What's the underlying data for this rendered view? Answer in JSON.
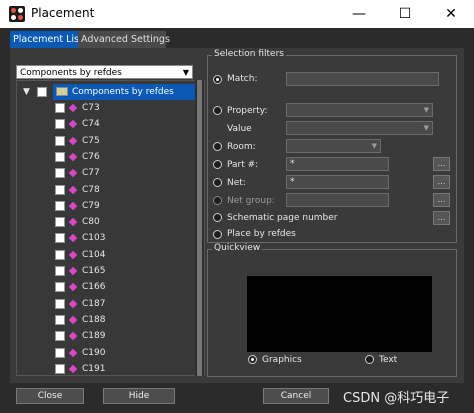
{
  "window": {
    "title": "Placement"
  },
  "tabs": [
    {
      "label": "Placement List"
    },
    {
      "label": "Advanced Settings"
    }
  ],
  "list": {
    "combo_value": "Components by refdes",
    "root_label": "Components by refdes",
    "items": [
      "C73",
      "C74",
      "C75",
      "C76",
      "C77",
      "C78",
      "C79",
      "C80",
      "C103",
      "C104",
      "C165",
      "C166",
      "C187",
      "C188",
      "C189",
      "C190",
      "C191"
    ]
  },
  "selection_filters": {
    "title": "Selection filters",
    "match_label": "Match:",
    "property_label": "Property:",
    "value_label": "Value",
    "room_label": "Room:",
    "part_label": "Part #:",
    "part_value": "*",
    "net_label": "Net:",
    "net_value": "*",
    "net_group_label": "Net group:",
    "schematic_label": "Schematic page number",
    "place_label": "Place by refdes"
  },
  "quickview": {
    "title": "Quickview",
    "graphics_label": "Graphics",
    "text_label": "Text"
  },
  "buttons": {
    "close": "Close",
    "hide": "Hide",
    "cancel": "Cancel"
  },
  "watermark": "CSDN @科巧电子"
}
